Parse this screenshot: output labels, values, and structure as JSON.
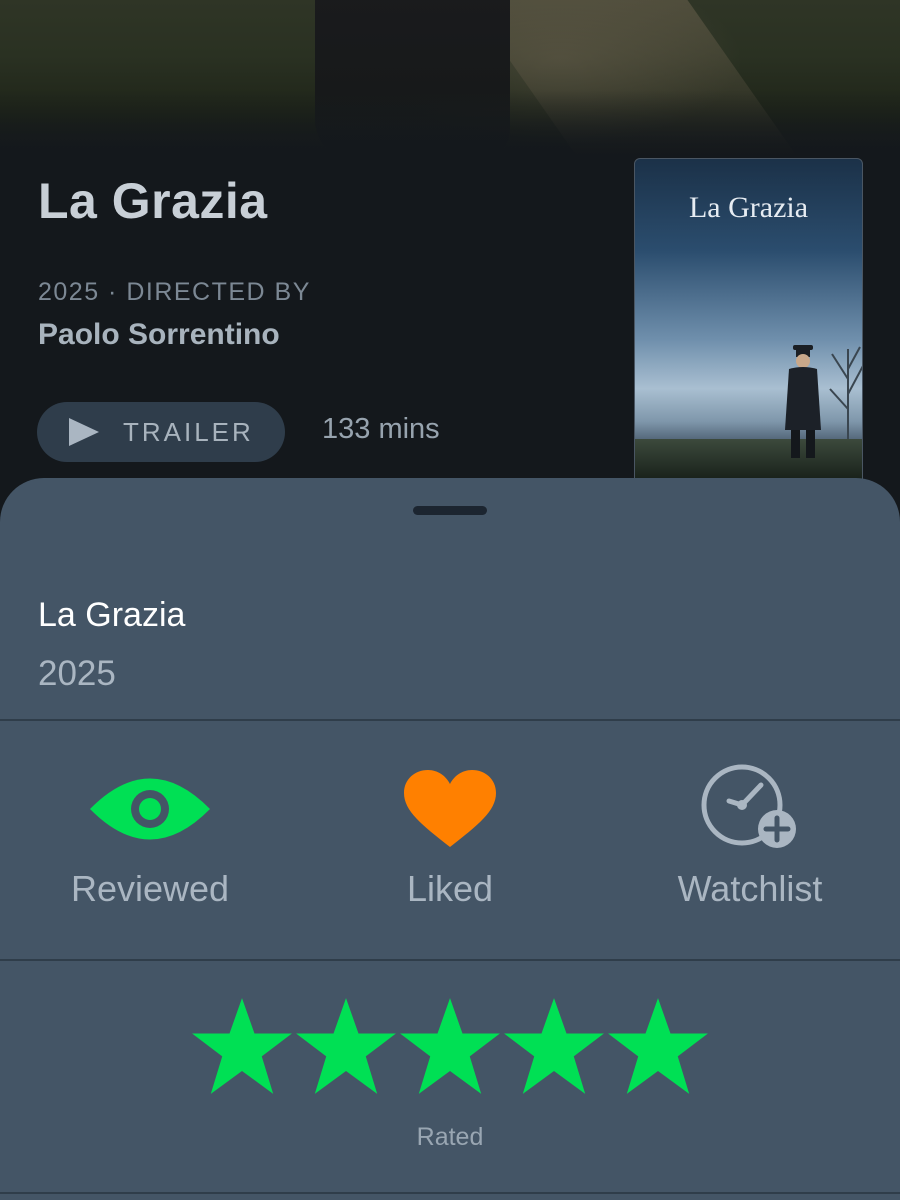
{
  "header": {
    "title": "La Grazia",
    "meta": "2025 · DIRECTED BY",
    "director": "Paolo Sorrentino",
    "trailer_label": "TRAILER",
    "runtime": "133 mins",
    "poster_title": "La Grazia"
  },
  "sheet": {
    "title": "La Grazia",
    "year": "2025",
    "actions": [
      {
        "label": "Reviewed",
        "icon": "eye-icon",
        "color": "#00e054",
        "active": true
      },
      {
        "label": "Liked",
        "icon": "heart-icon",
        "color": "#ff8000",
        "active": true
      },
      {
        "label": "Watchlist",
        "icon": "clock-plus-icon",
        "color": "#aab6c2",
        "active": false
      }
    ],
    "rating": {
      "stars": 5,
      "max": 5,
      "color": "#00e054",
      "label": "Rated"
    }
  }
}
